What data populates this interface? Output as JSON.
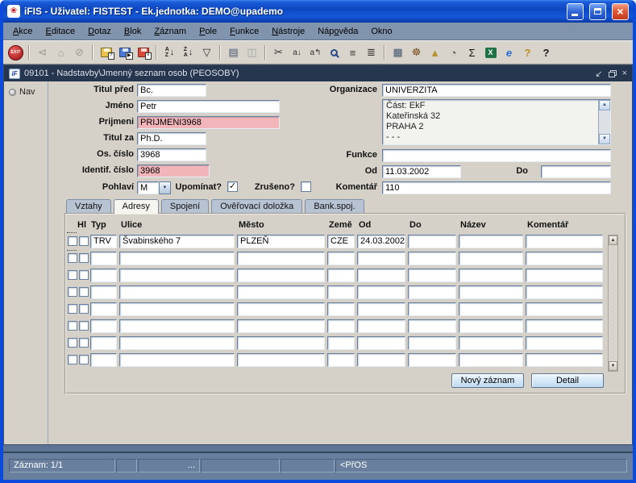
{
  "window": {
    "title": "iFIS - Uživatel: FISTEST - Ek.jednotka: DEMO@upademo",
    "logo_glyph": "❀"
  },
  "menu": {
    "items": [
      {
        "label": "Akce",
        "mnemonic": 0
      },
      {
        "label": "Editace",
        "mnemonic": 0
      },
      {
        "label": "Dotaz",
        "mnemonic": 0
      },
      {
        "label": "Blok",
        "mnemonic": 0
      },
      {
        "label": "Záznam",
        "mnemonic": 0
      },
      {
        "label": "Pole",
        "mnemonic": 0
      },
      {
        "label": "Funkce",
        "mnemonic": 0
      },
      {
        "label": "Nástroje",
        "mnemonic": 0
      },
      {
        "label": "Nápověda",
        "mnemonic": 3
      },
      {
        "label": "Okno",
        "mnemonic": -1
      }
    ]
  },
  "toolbar": {
    "icons": [
      {
        "name": "exit-icon",
        "type": "exit",
        "label": "EXIT"
      },
      {
        "type": "sep"
      },
      {
        "name": "message-send-icon",
        "glyph": "⊲",
        "color": "#444",
        "disabled": true
      },
      {
        "name": "message-home-icon",
        "glyph": "⌂",
        "color": "#444",
        "disabled": true
      },
      {
        "name": "message-cancel-icon",
        "glyph": "⊘",
        "color": "#444",
        "disabled": true
      },
      {
        "type": "sep"
      },
      {
        "name": "save-query-icon",
        "type": "floppy",
        "color": "#e8c24a",
        "badge": "?"
      },
      {
        "name": "execute-query-icon",
        "type": "floppy",
        "color": "#4a78d8",
        "badge": "▶"
      },
      {
        "name": "cancel-query-icon",
        "type": "floppy",
        "color": "#d84a3a",
        "badge": "×"
      },
      {
        "type": "sep"
      },
      {
        "name": "sort-ascending-icon",
        "type": "sort",
        "letters": "AZ"
      },
      {
        "name": "sort-descending-icon",
        "type": "sort",
        "letters": "ZA"
      },
      {
        "name": "filter-icon",
        "glyph": "▽",
        "color": "#333"
      },
      {
        "type": "sep"
      },
      {
        "name": "print-icon",
        "glyph": "▤",
        "color": "#44566e"
      },
      {
        "name": "print-preview-icon",
        "glyph": "◫",
        "color": "#44566e",
        "disabled": true
      },
      {
        "type": "sep"
      },
      {
        "name": "cut-icon",
        "glyph": "✂",
        "color": "#333"
      },
      {
        "name": "copy-field-icon",
        "glyph": "a↓",
        "color": "#333",
        "small": true
      },
      {
        "name": "copy-record-icon",
        "glyph": "a↰",
        "color": "#333",
        "small": true
      },
      {
        "name": "find-icon",
        "type": "magnifier"
      },
      {
        "name": "record-list-icon",
        "glyph": "≡",
        "color": "#333"
      },
      {
        "name": "block-list-icon",
        "glyph": "≣",
        "color": "#333"
      },
      {
        "type": "sep"
      },
      {
        "name": "edit-window-icon",
        "glyph": "▦",
        "color": "#44566e"
      },
      {
        "name": "helm-icon",
        "glyph": "☸",
        "color": "#7a4f1d"
      },
      {
        "name": "alert-icon",
        "glyph": "▲",
        "color": "#b89230"
      },
      {
        "name": "gauge-icon",
        "glyph": "◔",
        "color": "#555"
      },
      {
        "name": "sum-icon",
        "glyph": "Σ",
        "color": "#111"
      },
      {
        "name": "excel-icon",
        "type": "badge",
        "bg": "#1e7145",
        "fg": "#fff",
        "letter": "X"
      },
      {
        "name": "browser-icon",
        "glyph": "e",
        "color": "#2a6ad8",
        "bold": true,
        "italic": true
      },
      {
        "name": "user-help-icon",
        "glyph": "?",
        "color": "#c08a1a",
        "bold": true
      },
      {
        "name": "context-help-icon",
        "glyph": "?",
        "color": "#1a1a1a",
        "bold": true
      }
    ]
  },
  "mdi": {
    "title": "09101 - Nadstavby\\Jmenný seznam osob (PEOSOBY)",
    "logo_text": "iF"
  },
  "nav": {
    "label": "Nav"
  },
  "form": {
    "titul_pred": {
      "label": "Titul před",
      "value": "Bc."
    },
    "jmeno": {
      "label": "Jméno",
      "value": "Petr"
    },
    "prijmeni": {
      "label": "Prijmeni",
      "value": "PRIJMENI3968"
    },
    "titul_za": {
      "label": "Titul za",
      "value": "Ph.D."
    },
    "os_cislo": {
      "label": "Os. číslo",
      "value": "3968"
    },
    "identif_cislo": {
      "label": "Identif. číslo",
      "value": "3968"
    },
    "pohlavi": {
      "label": "Pohlaví",
      "value": "M"
    },
    "upominat": {
      "label": "Upomínat?",
      "checked": true
    },
    "zruseno": {
      "label": "Zrušeno?",
      "checked": false
    },
    "organizace": {
      "label": "Organizace",
      "value": "UNIVERZITA"
    },
    "org_adresa": {
      "lines": [
        "Část: EkF",
        "Kateřinská 32",
        "PRAHA 2",
        "- - -"
      ]
    },
    "funkce": {
      "label": "Funkce",
      "value": ""
    },
    "od": {
      "label": "Od",
      "value": "11.03.2002"
    },
    "do": {
      "label": "Do",
      "value": ""
    },
    "komentar": {
      "label": "Komentář",
      "value": "110"
    }
  },
  "tabs": [
    {
      "label": "Vztahy",
      "active": false
    },
    {
      "label": "Adresy",
      "active": true
    },
    {
      "label": "Spojení",
      "active": false
    },
    {
      "label": "Ověřovací doložka",
      "active": false
    },
    {
      "label": "Bank.spoj.",
      "active": false
    }
  ],
  "address_table": {
    "columns": [
      "Hl",
      "Typ",
      "Ulice",
      "Město",
      "Země",
      "Od",
      "Do",
      "Název",
      "Komentář"
    ],
    "rows": [
      {
        "typ": "TRV",
        "ulice": "Švabinského 7",
        "mesto": "PLZEŇ",
        "zeme": "CZE",
        "od": "24.03.2002",
        "do": "",
        "nazev": "",
        "komentar": "",
        "current": true
      },
      {},
      {},
      {},
      {},
      {},
      {},
      {}
    ],
    "buttons": [
      {
        "label": "Nový záznam"
      },
      {
        "label": "Detail"
      }
    ]
  },
  "status_bar": {
    "cells": [
      "Záznam: 1/1",
      "",
      "...",
      "",
      "",
      "<PřOS"
    ]
  },
  "colors": {
    "titlebar_blue": "#1455d6",
    "mdi_titlebar": "#26364e",
    "field_pink": "#f2b6ba",
    "row_highlight": "#cfe5f8",
    "button_blue": "#cde3f6",
    "statusbar": "#68809e"
  }
}
